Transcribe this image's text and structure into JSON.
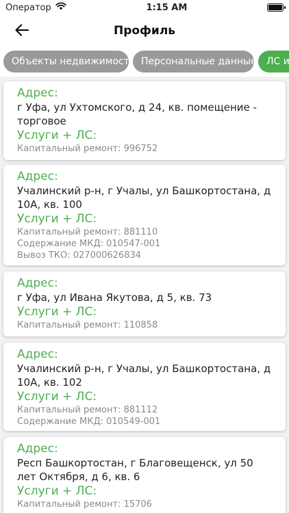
{
  "status_bar": {
    "carrier": "Оператор",
    "time": "1:15 AM"
  },
  "header": {
    "title": "Профиль"
  },
  "tabs": [
    {
      "label": "Объекты недвижимости",
      "active": false
    },
    {
      "label": "Персональные данные",
      "active": false
    },
    {
      "label": "ЛС и",
      "active": true
    }
  ],
  "labels": {
    "address": "Адрес:",
    "services": "Услуги + ЛС:"
  },
  "cards": [
    {
      "address": "г Уфа, ул Ухтомского, д 24, кв. помещение - торговое",
      "accounts": [
        "Капитальный ремонт: 996752"
      ]
    },
    {
      "address": "Учалинский р-н, г Учалы, ул Башкортостана, д 10А, кв. 100",
      "accounts": [
        "Капитальный ремонт: 881110",
        "Содержание МКД: 010547-001",
        "Вывоз ТКО: 027000626834"
      ]
    },
    {
      "address": "г Уфа, ул Ивана Якутова, д 5, кв. 73",
      "accounts": [
        "Капитальный ремонт: 110858"
      ]
    },
    {
      "address": "Учалинский р-н, г Учалы, ул Башкортостана, д 10А, кв. 102",
      "accounts": [
        "Капитальный ремонт: 881112",
        "Содержание МКД: 010549-001"
      ]
    },
    {
      "address": "Респ Башкортостан, г Благовещенск, ул 50 лет Октября, д 6, кв. 6",
      "accounts": [
        "Капитальный ремонт: 15706"
      ]
    }
  ],
  "colors": {
    "accent": "#4caf50",
    "tab_inactive": "#9a9a9a",
    "background": "#f2f2f2"
  },
  "icons": {
    "back": "arrow-left-icon",
    "wifi": "wifi-icon",
    "battery": "battery-icon"
  }
}
